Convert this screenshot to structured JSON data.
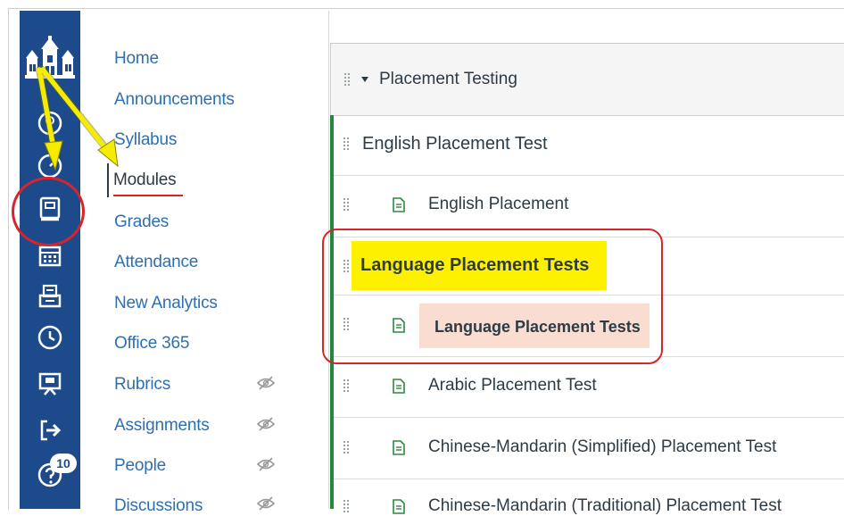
{
  "course_nav": {
    "items": [
      {
        "label": "Home",
        "active": false,
        "hidden": false
      },
      {
        "label": "Announcements",
        "active": false,
        "hidden": false
      },
      {
        "label": "Syllabus",
        "active": false,
        "hidden": false
      },
      {
        "label": "Modules",
        "active": true,
        "hidden": false
      },
      {
        "label": "Grades",
        "active": false,
        "hidden": false
      },
      {
        "label": "Attendance",
        "active": false,
        "hidden": false
      },
      {
        "label": "New Analytics",
        "active": false,
        "hidden": false
      },
      {
        "label": "Office 365",
        "active": false,
        "hidden": false
      },
      {
        "label": "Rubrics",
        "active": false,
        "hidden": true
      },
      {
        "label": "Assignments",
        "active": false,
        "hidden": true
      },
      {
        "label": "People",
        "active": false,
        "hidden": true
      },
      {
        "label": "Discussions",
        "active": false,
        "hidden": true
      }
    ]
  },
  "global_nav": {
    "icons": [
      "institution-logo-icon",
      "account-icon",
      "dashboard-icon",
      "courses-icon",
      "calendar-icon",
      "inbox-icon",
      "history-icon",
      "studio-icon",
      "logout-icon",
      "help-icon"
    ],
    "help_badge": "10",
    "colors": {
      "nav_bg": "#1d4a8a",
      "link": "#2d6fb2",
      "module_rail": "#1f8a3c",
      "annotation_red": "#d6252a",
      "arrow_yellow": "#f5ec00"
    }
  },
  "module": {
    "title": "Placement Testing",
    "rows": [
      {
        "type": "subheader",
        "text": "English Placement Test"
      },
      {
        "type": "page",
        "text": "English Placement"
      },
      {
        "type": "subheader",
        "text": "Language Placement Tests",
        "highlight": "yellow"
      },
      {
        "type": "page",
        "text": "Language Placement Tests",
        "highlight": "peach"
      },
      {
        "type": "page",
        "text": "Arabic Placement Test"
      },
      {
        "type": "page",
        "text": "Chinese-Mandarin (Simplified) Placement Test"
      },
      {
        "type": "page",
        "text": "Chinese-Mandarin (Traditional) Placement Test"
      }
    ]
  }
}
